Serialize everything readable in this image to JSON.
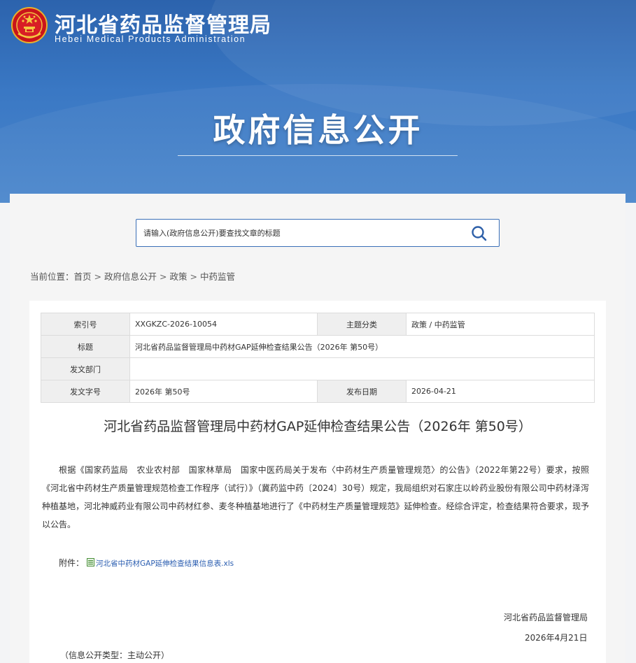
{
  "header": {
    "org_name_cn": "河北省药品监督管理局",
    "org_name_en": "Hebei Medical Products Administration",
    "section_title": "政府信息公开"
  },
  "search": {
    "placeholder": "请输入(政府信息公开)要查找文章的标题",
    "icon": "search-icon"
  },
  "breadcrumb": {
    "prefix": "当前位置：",
    "items": [
      "首页",
      "政府信息公开",
      "政策",
      "中药监管"
    ],
    "separator": ">"
  },
  "meta": {
    "index_label": "索引号",
    "index_value": "XXGKZC-2026-10054",
    "topic_label": "主题分类",
    "topic_value": "政策 / 中药监管",
    "title_label": "标题",
    "title_value": "河北省药品监督管理局中药材GAP延伸检查结果公告（2026年 第50号）",
    "dept_label": "发文部门",
    "dept_value": "",
    "docno_label": "发文字号",
    "docno_value": "2026年 第50号",
    "date_label": "发布日期",
    "date_value": "2026-04-21"
  },
  "article": {
    "title": "河北省药品监督管理局中药材GAP延伸检查结果公告（2026年 第50号）",
    "body": "根据《国家药监局　农业农村部　国家林草局　国家中医药局关于发布〈中药材生产质量管理规范〉的公告》（2022年第22号）要求，按照《河北省中药材生产质量管理规范检查工作程序（试行）》（冀药监中药〔2024〕30号）规定，我局组织对石家庄以岭药业股份有限公司中药材泽泻种植基地，河北神威药业有限公司中药材红参、麦冬种植基地进行了《中药材生产质量管理规范》延伸检查。经综合评定，检查结果符合要求，现予以公告。",
    "attachment_label": "附件：",
    "attachment_file": "河北省中药材GAP延伸检查结果信息表.xls",
    "signature_org": "河北省药品监督管理局",
    "signature_date": "2026年4月21日",
    "disclosure_type": "（信息公开类型：主动公开）"
  },
  "colors": {
    "banner_blue": "#3a78c4",
    "link_blue": "#2a5db0",
    "search_border": "#3a6fb7"
  }
}
